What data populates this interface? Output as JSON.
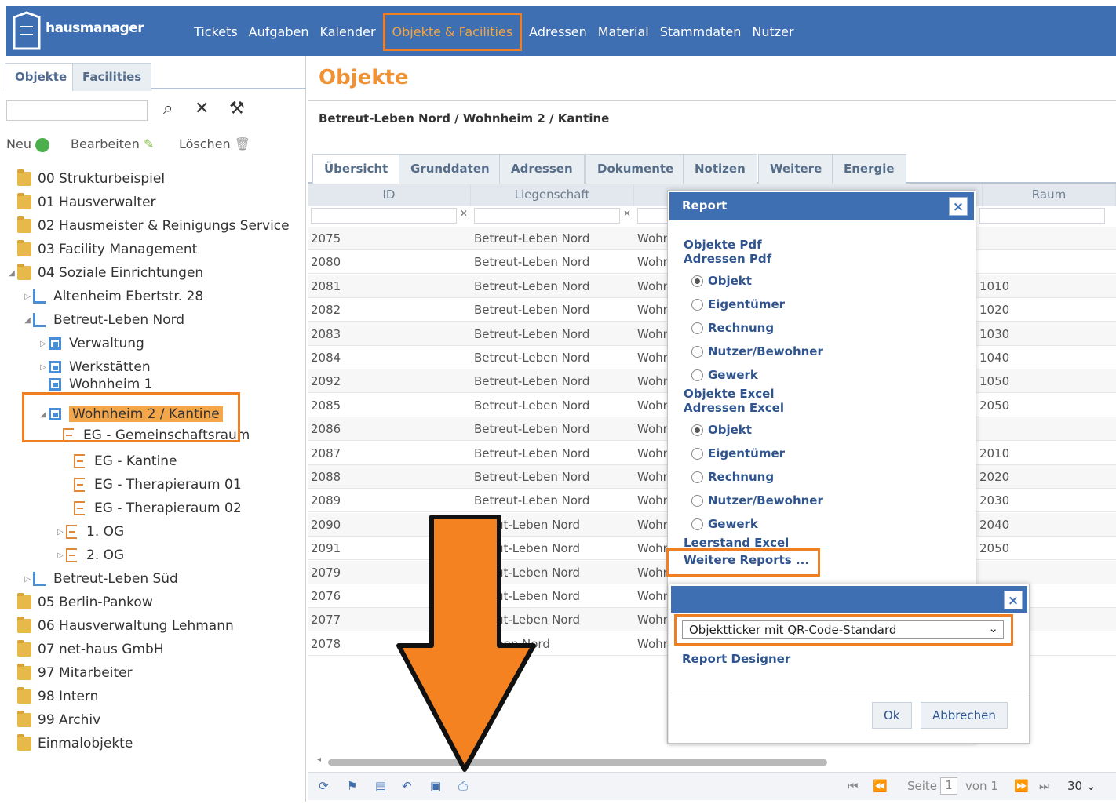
{
  "app": {
    "logo_text": "hausmanager"
  },
  "nav": {
    "items": [
      "Tickets",
      "Aufgaben",
      "Kalender",
      "Objekte & Facilities",
      "Adressen",
      "Material",
      "Stammdaten",
      "Nutzer"
    ],
    "active": "Objekte & Facilities"
  },
  "left": {
    "tabs": [
      "Objekte",
      "Facilities"
    ],
    "toolbar": {
      "new": "Neu",
      "edit": "Bearbeiten",
      "delete": "Löschen"
    },
    "tree": [
      "00 Strukturbeispiel",
      "01 Hausverwalter",
      "02 Hausmeister & Reinigungs Service",
      "03 Facility Management",
      "04 Soziale Einrichtungen",
      "Altenheim Ebertstr. 28",
      "Betreut-Leben Nord",
      "Verwaltung",
      "Werkstätten",
      "Wohnheim 1",
      "Wohnheim 2 / Kantine",
      "EG - Gemeinschaftsraum",
      "EG - Kantine",
      "EG - Therapieraum 01",
      "EG - Therapieraum 02",
      "1. OG",
      "2. OG",
      "Betreut-Leben Süd",
      "05 Berlin-Pankow",
      "06 Hausverwaltung Lehmann",
      "07 net-haus GmbH",
      "97 Mitarbeiter",
      "98 Intern",
      "99 Archiv",
      "Einmalobjekte"
    ]
  },
  "main": {
    "title": "Objekte",
    "breadcrumb": "Betreut-Leben Nord / Wohnheim 2 / Kantine",
    "tabs": [
      "Übersicht",
      "Grunddaten",
      "Adressen",
      "Dokumente",
      "Notizen",
      "Weitere",
      "Energie"
    ],
    "columns": [
      "ID",
      "Liegenschaft",
      "Raum"
    ],
    "rows": [
      [
        "2075",
        "Betreut-Leben Nord",
        "Wohn",
        ""
      ],
      [
        "2080",
        "Betreut-Leben Nord",
        "Wohn",
        ""
      ],
      [
        "2081",
        "Betreut-Leben Nord",
        "Wohn",
        "1010"
      ],
      [
        "2082",
        "Betreut-Leben Nord",
        "Wohn",
        "1020"
      ],
      [
        "2083",
        "Betreut-Leben Nord",
        "Wohn",
        "1030"
      ],
      [
        "2084",
        "Betreut-Leben Nord",
        "Wohn",
        "1040"
      ],
      [
        "2092",
        "Betreut-Leben Nord",
        "Wohn",
        "1050"
      ],
      [
        "2085",
        "Betreut-Leben Nord",
        "Wohn",
        "2050"
      ],
      [
        "2086",
        "Betreut-Leben Nord",
        "Wohn",
        ""
      ],
      [
        "2087",
        "Betreut-Leben Nord",
        "Wohn",
        "2010"
      ],
      [
        "2088",
        "Betreut-Leben Nord",
        "Wohn",
        "2020"
      ],
      [
        "2089",
        "Betreut-Leben Nord",
        "Wohn",
        "2030"
      ],
      [
        "2090",
        "ut-Leben Nord",
        "Wohn",
        "2040"
      ],
      [
        "2091",
        "ut-Leben Nord",
        "Wohn",
        "2050"
      ],
      [
        "2079",
        "ut-Leben Nord",
        "Wohn",
        ""
      ],
      [
        "2076",
        "ut-Leben Nord",
        "Wohn",
        ""
      ],
      [
        "2077",
        "ut-Leben Nord",
        "Wohn",
        ""
      ],
      [
        "2078",
        "ben Nord",
        "Wohn",
        ""
      ]
    ],
    "pager": {
      "page_label": "Seite",
      "page": "1",
      "of_label": "von 1",
      "per_page": "30"
    }
  },
  "report": {
    "title": "Report",
    "close": "×",
    "objects_pdf": "Objekte Pdf",
    "addresses_pdf": "Adressen Pdf",
    "pdf_options": [
      "Objekt",
      "Eigentümer",
      "Rechnung",
      "Nutzer/Bewohner",
      "Gewerk"
    ],
    "objects_excel": "Objekte Excel",
    "addresses_excel": "Adressen Excel",
    "excel_options": [
      "Objekt",
      "Eigentümer",
      "Rechnung",
      "Nutzer/Bewohner",
      "Gewerk"
    ],
    "vacancy_excel": "Leerstand Excel",
    "more_reports": "Weitere Reports ..."
  },
  "subdialog": {
    "close": "×",
    "selected": "Objektticker mit QR-Code-Standard",
    "designer": "Report Designer",
    "ok": "Ok",
    "cancel": "Abbrechen"
  },
  "colors": {
    "brand": "#3f6fb3",
    "accent": "#f07f24",
    "title": "#f09234"
  }
}
